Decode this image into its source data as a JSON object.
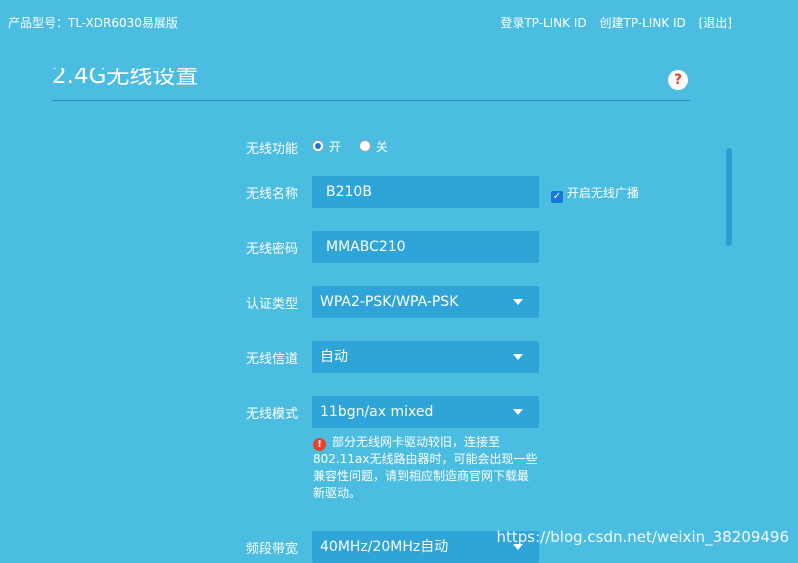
{
  "header": {
    "product_model": "产品型号：TL-XDR6030易展版",
    "login": "登录TP-LINK ID",
    "create": "创建TP-LINK ID",
    "logout": "[退出]"
  },
  "section": {
    "title": "2.4G无线设置",
    "help_symbol": "?"
  },
  "form": {
    "wireless_function": {
      "label": "无线功能",
      "on": "开",
      "off": "关",
      "selected": "开"
    },
    "ssid": {
      "label": "无线名称",
      "value": "B210B",
      "broadcast_label": "开启无线广播",
      "broadcast_checked": true
    },
    "password": {
      "label": "无线密码",
      "value": "MMABC210"
    },
    "auth": {
      "label": "认证类型",
      "value": "WPA2-PSK/WPA-PSK"
    },
    "channel": {
      "label": "无线信道",
      "value": "自动"
    },
    "mode": {
      "label": "无线模式",
      "value": "11bgn/ax mixed",
      "warning": "部分无线网卡驱动较旧，连接至802.11ax无线路由器时，可能会出现一些兼容性问题，请到相应制造商官网下载最新驱动。"
    },
    "bandwidth": {
      "label": "频段带宽",
      "value": "40MHz/20MHz自动"
    }
  },
  "watermark": "https://blog.csdn.net/weixin_38209496",
  "colors": {
    "background": "#4bbde0",
    "field": "#2ea4d8",
    "accent": "#1677d8",
    "warning": "#e8412c"
  }
}
